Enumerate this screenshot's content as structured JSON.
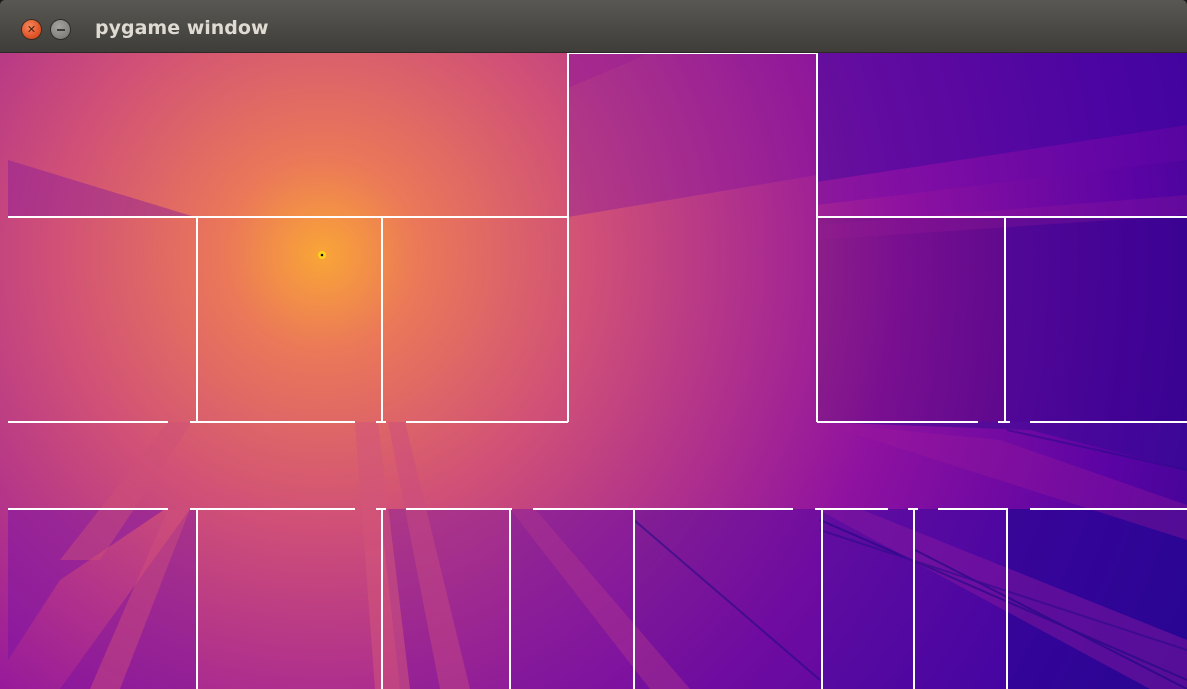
{
  "window": {
    "title": "pygame window"
  },
  "colors": {
    "light_center": "#f9a537",
    "warm_magenta": "#cf4f78",
    "mid_purple": "#8f12a0",
    "deep_indigo": "#250887",
    "wall": "#ffffff"
  },
  "icons": {
    "close": "close-icon",
    "minimize": "minimize-icon",
    "light": "light-source-icon"
  }
}
